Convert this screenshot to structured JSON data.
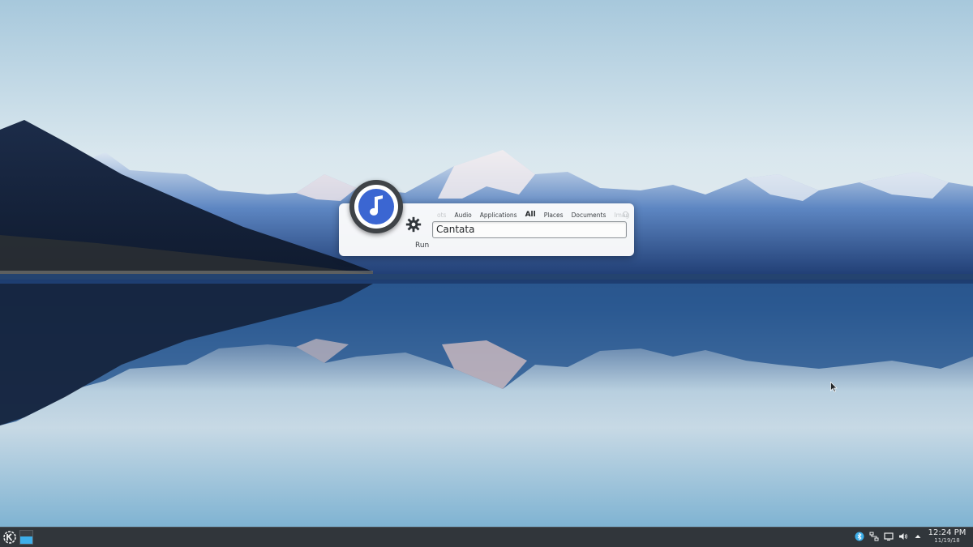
{
  "desktop": {
    "wallpaper": "mountain-lake-reflection"
  },
  "krunner": {
    "app_icon": "music-note-icon",
    "runner_icon": "gear-icon",
    "runner_label": "Run",
    "categories": [
      {
        "label": "ots",
        "state": "faded"
      },
      {
        "label": "Audio",
        "state": "normal"
      },
      {
        "label": "Applications",
        "state": "normal"
      },
      {
        "label": "All",
        "state": "active"
      },
      {
        "label": "Places",
        "state": "normal"
      },
      {
        "label": "Documents",
        "state": "normal"
      },
      {
        "label": "Imag",
        "state": "faded"
      }
    ],
    "query": "Cantata"
  },
  "taskbar": {
    "launcher_icon": "kde-logo-icon",
    "tray_icons": [
      "bluetooth-icon",
      "network-icon",
      "display-icon",
      "volume-icon",
      "chevron-up-icon"
    ],
    "clock": {
      "time": "12:24 PM",
      "date": "11/19/18"
    }
  },
  "colors": {
    "accent": "#3daee9",
    "panel": "#31363b",
    "music_icon": "#3b66d2"
  }
}
